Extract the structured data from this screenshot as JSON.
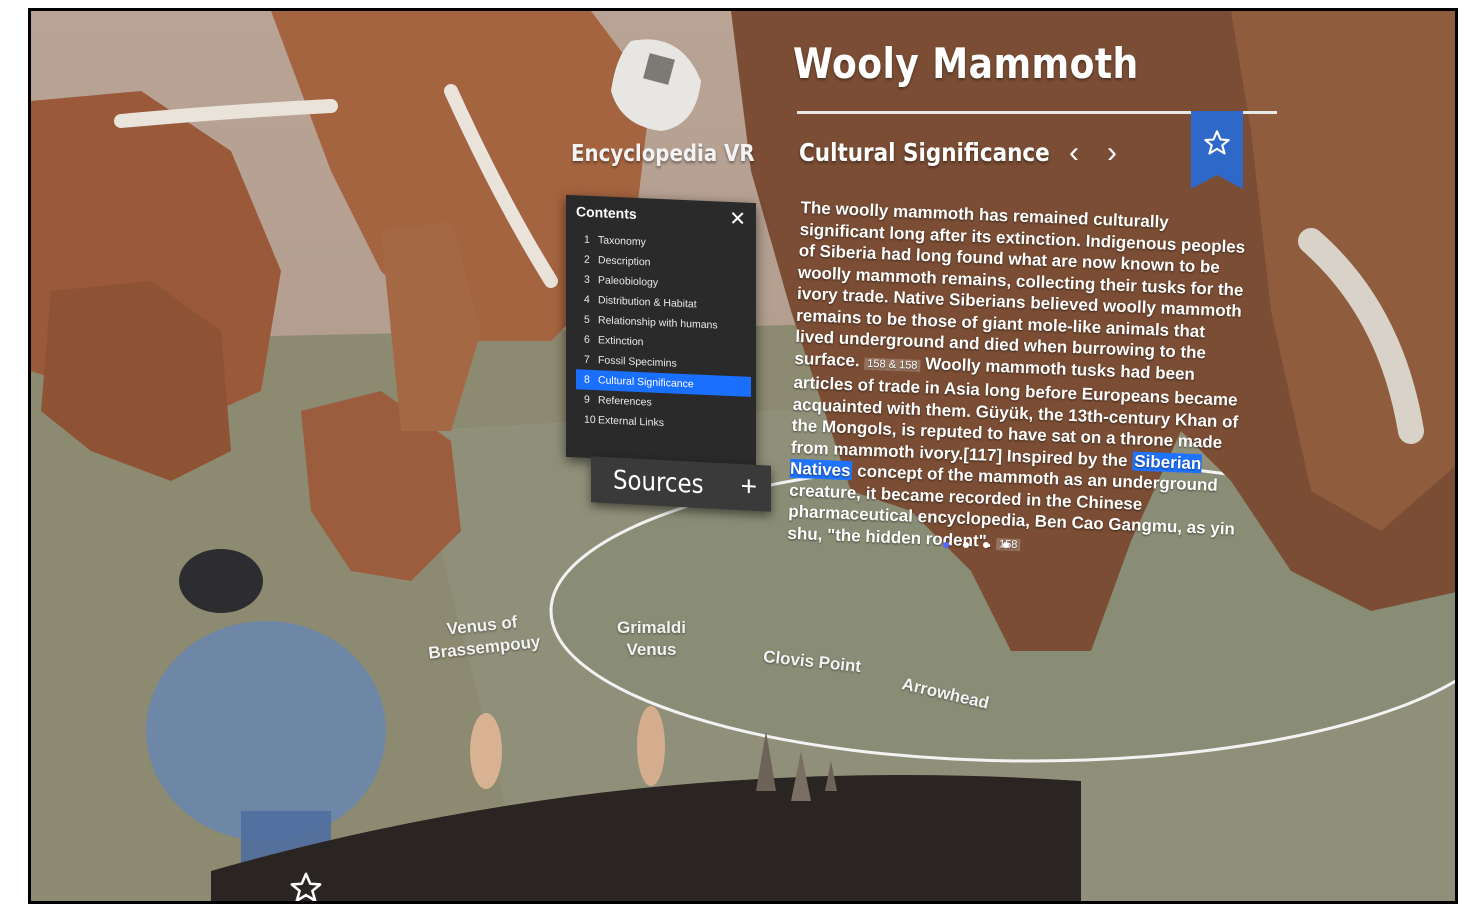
{
  "app": {
    "brand": "Encyclopedia VR"
  },
  "article": {
    "title": "Wooly Mammoth",
    "section_title": "Cultural Significance",
    "bookmark_icon": "star-icon",
    "prev_icon": "chevron-left-icon",
    "next_icon": "chevron-right-icon",
    "text_1": "The woolly mammoth has remained culturally significant long after its extinction. Indigenous peoples of Siberia had long found what are now known to be woolly mammoth remains, collecting their tusks for the ivory trade. Native Siberians believed woolly mammoth remains to be those of giant mole-like animals that lived underground and died when burrowing to the surface.",
    "cite_1": "158 & 158",
    "text_2": " Woolly mammoth tusks had been articles of trade in Asia long before Europeans became acquainted with them. Güyük, the 13th-century Khan of the Mongols, is reputed to have sat on a throne made from mammoth ivory.[117] Inspired by the ",
    "highlight": "Siberian Natives",
    "text_3": " concept of the mammoth as an underground creature, it became recorded in the Chinese pharmaceutical encyclopedia, Ben Cao Gangmu, as yin shu, \"the hidden rodent\".",
    "cite_2": "158",
    "page_indicator": {
      "count": 4,
      "active": 0
    }
  },
  "contents": {
    "heading": "Contents",
    "close_icon": "close-icon",
    "items": [
      {
        "num": "1",
        "label": "Taxonomy",
        "active": false
      },
      {
        "num": "2",
        "label": "Description",
        "active": false
      },
      {
        "num": "3",
        "label": "Paleobiology",
        "active": false
      },
      {
        "num": "4",
        "label": "Distribution & Habitat",
        "active": false
      },
      {
        "num": "5",
        "label": "Relationship with humans",
        "active": false
      },
      {
        "num": "6",
        "label": "Extinction",
        "active": false
      },
      {
        "num": "7",
        "label": "Fossil Specimins",
        "active": false
      },
      {
        "num": "8",
        "label": "Cultural Significance",
        "active": true
      },
      {
        "num": "9",
        "label": "References",
        "active": false
      },
      {
        "num": "10",
        "label": "External Links",
        "active": false
      }
    ]
  },
  "sources": {
    "label": "Sources",
    "add_icon": "plus-icon"
  },
  "artifacts": [
    {
      "line1": "Venus of",
      "line2": "Brassempouy"
    },
    {
      "line1": "Grimaldi",
      "line2": "Venus"
    },
    {
      "line1": "Clovis Point",
      "line2": ""
    },
    {
      "line1": "Arrowhead",
      "line2": ""
    }
  ],
  "colors": {
    "accent": "#1a6fff",
    "bookmark": "#2e68c9",
    "panel": "#2a2a2a"
  }
}
